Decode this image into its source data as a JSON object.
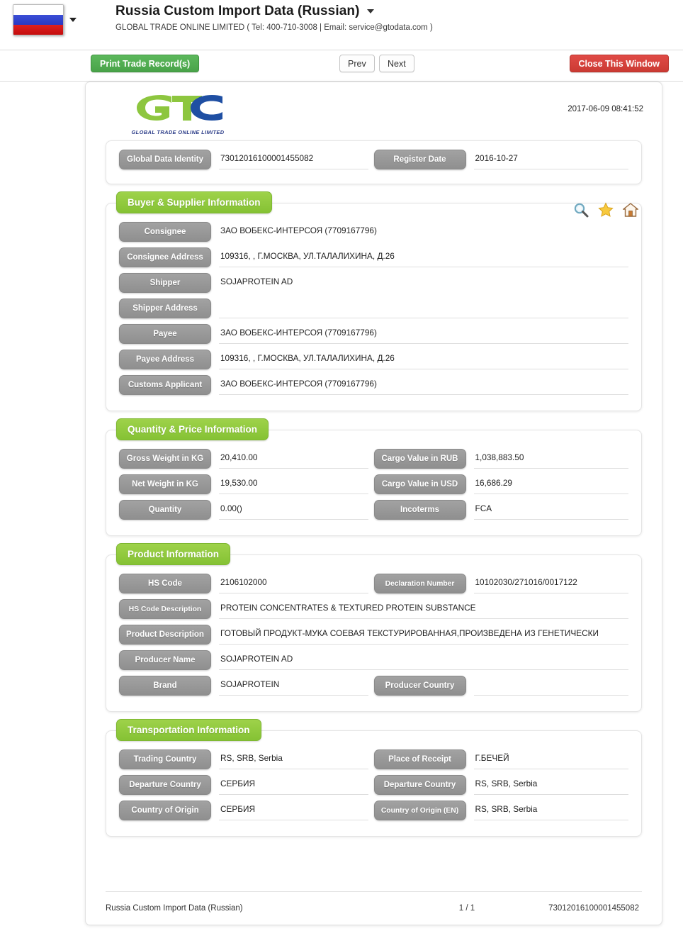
{
  "header": {
    "flag_icon": "russia-flag-icon",
    "dropdown_icon": "chevron-down-icon",
    "title": "Russia Custom Import Data (Russian)",
    "subtitle": "GLOBAL TRADE ONLINE LIMITED ( Tel: 400-710-3008 | Email: service@gtodata.com )"
  },
  "toolbar": {
    "print_label": "Print Trade Record(s)",
    "prev_label": "Prev",
    "next_label": "Next",
    "close_label": "Close This Window"
  },
  "sheet": {
    "logo_text": "GTO",
    "logo_caption": "GLOBAL TRADE  ONLINE LIMITED",
    "timestamp": "2017-06-09 08:41:52"
  },
  "identity": {
    "global_data_identity_label": "Global Data Identity",
    "global_data_identity_value": "73012016100001455082",
    "register_date_label": "Register Date",
    "register_date_value": "2016-10-27"
  },
  "buyer_supplier": {
    "title": "Buyer & Supplier Information",
    "icons": [
      "search-icon",
      "star-icon",
      "home-icon"
    ],
    "rows": [
      {
        "label": "Consignee",
        "value": "ЗАО ВОБЕКС-ИНТЕРСОЯ (7709167796)"
      },
      {
        "label": "Consignee Address",
        "value": "109316, , Г.МОСКВА, УЛ.ТАЛАЛИХИНА, Д.26"
      },
      {
        "label": "Shipper",
        "value": "SOJAPROTEIN AD"
      },
      {
        "label": "Shipper Address",
        "value": ""
      },
      {
        "label": "Payee",
        "value": "ЗАО ВОБЕКС-ИНТЕРСОЯ  (7709167796)"
      },
      {
        "label": "Payee Address",
        "value": "109316, , Г.МОСКВА, УЛ.ТАЛАЛИХИНА, Д.26"
      },
      {
        "label": "Customs Applicant",
        "value": "ЗАО ВОБЕКС-ИНТЕРСОЯ  (7709167796)"
      }
    ]
  },
  "quantity_price": {
    "title": "Quantity & Price Information",
    "rows": [
      {
        "left_label": "Gross Weight in KG",
        "left_value": "20,410.00",
        "right_label": "Cargo Value in RUB",
        "right_value": "1,038,883.50"
      },
      {
        "left_label": "Net Weight in KG",
        "left_value": "19,530.00",
        "right_label": "Cargo Value in USD",
        "right_value": "16,686.29"
      },
      {
        "left_label": "Quantity",
        "left_value": "0.00()",
        "right_label": "Incoterms",
        "right_value": "FCA"
      }
    ]
  },
  "product": {
    "title": "Product Information",
    "hs_code_label": "HS Code",
    "hs_code_value": "2106102000",
    "declaration_number_label": "Declaration Number",
    "declaration_number_value": "10102030/271016/0017122",
    "hs_code_desc_label": "HS Code Description",
    "hs_code_desc_value": "PROTEIN CONCENTRATES & TEXTURED PROTEIN SUBSTANCE",
    "product_desc_label": "Product Description",
    "product_desc_value": "ГОТОВЫЙ ПРОДУКТ-МУКА СОЕВАЯ ТЕКСТУРИРОВАННАЯ,ПРОИЗВЕДЕНА ИЗ ГЕНЕТИЧЕСКИ",
    "producer_name_label": "Producer Name",
    "producer_name_value": "SOJAPROTEIN AD",
    "brand_label": "Brand",
    "brand_value": "SOJAPROTEIN",
    "producer_country_label": "Producer Country",
    "producer_country_value": ""
  },
  "transportation": {
    "title": "Transportation Information",
    "rows": [
      {
        "left_label": "Trading Country",
        "left_value": "RS, SRB, Serbia",
        "right_label": "Place of Receipt",
        "right_value": "Г.БЕЧЕЙ"
      },
      {
        "left_label": "Departure Country",
        "left_value": "СЕРБИЯ",
        "right_label": "Departure Country",
        "right_value": "RS, SRB, Serbia"
      },
      {
        "left_label": "Country of Origin",
        "left_value": "СЕРБИЯ",
        "right_label": "Country of Origin (EN)",
        "right_value": "RS, SRB, Serbia"
      }
    ]
  },
  "footer": {
    "left": "Russia Custom Import Data (Russian)",
    "page": "1 / 1",
    "right": "73012016100001455082"
  }
}
